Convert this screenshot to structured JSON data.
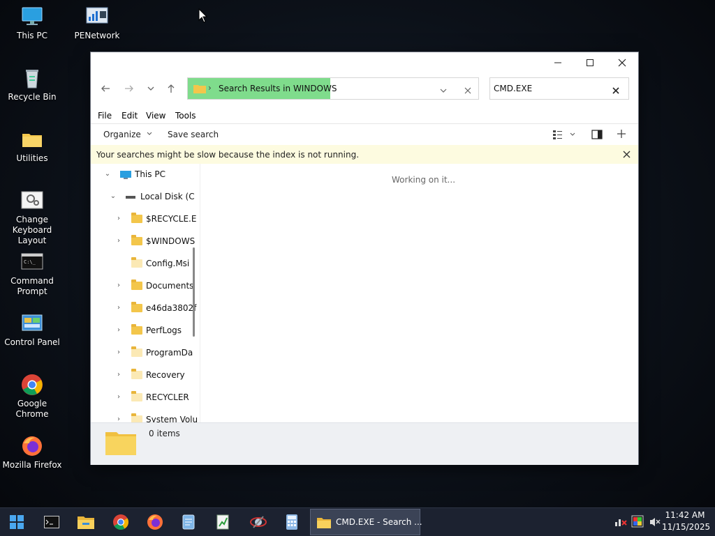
{
  "desktop": {
    "icons": [
      {
        "label": "This PC",
        "icon": "monitor-icon"
      },
      {
        "label": "PENetwork",
        "icon": "network-icon"
      },
      {
        "label": "Recycle Bin",
        "icon": "recycle-bin-icon"
      },
      {
        "label": "Utilities",
        "icon": "folder-icon"
      },
      {
        "label": "Change Keyboard Layout",
        "icon": "keyboard-settings-icon"
      },
      {
        "label": "Command Prompt",
        "icon": "terminal-icon"
      },
      {
        "label": "Control Panel",
        "icon": "control-panel-icon"
      },
      {
        "label": "Google Chrome",
        "icon": "chrome-icon"
      },
      {
        "label": "Mozilla Firefox",
        "icon": "firefox-icon"
      }
    ]
  },
  "window": {
    "address": {
      "location": "Search Results in WINDOWS"
    },
    "search": {
      "value": "CMD.EXE"
    },
    "menu": [
      "File",
      "Edit",
      "View",
      "Tools"
    ],
    "commands": {
      "organize": "Organize",
      "save_search": "Save search"
    },
    "infobar": {
      "message": "Your searches might be slow because the index is not running."
    },
    "tree": {
      "root": "This PC",
      "drive": "Local Disk (C",
      "items": [
        "$RECYCLE.E",
        "$WINDOWS",
        "Config.Msi",
        "Documents",
        "e46da3802f",
        "PerfLogs",
        "ProgramDa",
        "Recovery",
        "RECYCLER",
        "System Volu"
      ]
    },
    "content": {
      "status": "Working on it..."
    },
    "statusbar": {
      "count": "0 items"
    }
  },
  "taskbar": {
    "active_window": "CMD.EXE - Search ...",
    "apps": [
      "start-icon",
      "terminal-icon",
      "file-explorer-icon",
      "chrome-icon",
      "firefox-icon",
      "notepad-icon",
      "spreadsheet-icon",
      "network-tool-icon",
      "calculator-icon"
    ],
    "clock": {
      "time": "11:42 AM",
      "date": "11/15/2025"
    }
  },
  "colors": {
    "address_highlight": "#7fdc8c",
    "infobar_bg": "#fdfbe0",
    "folder": "#f3c64b",
    "taskbar": "#1c2230"
  }
}
